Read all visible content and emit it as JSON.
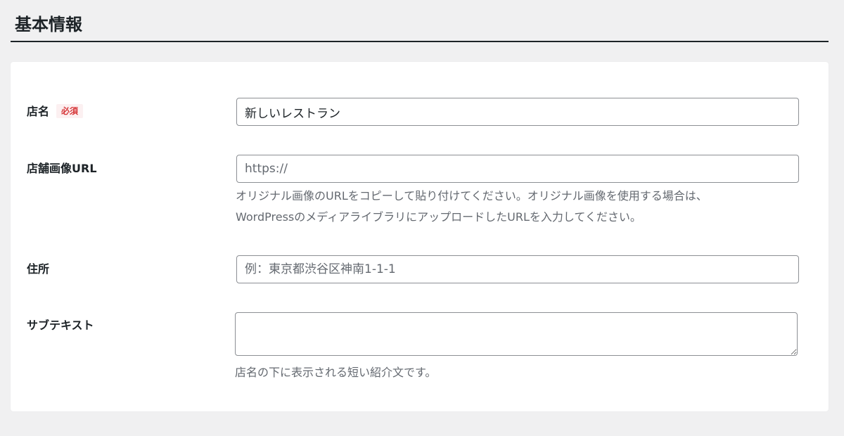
{
  "section": {
    "title": "基本情報"
  },
  "fields": {
    "shop_name": {
      "label": "店名",
      "required_badge": "必須",
      "value": "新しいレストラン"
    },
    "shop_image_url": {
      "label": "店舗画像URL",
      "placeholder": "https://",
      "help_line1": "オリジナル画像のURLをコピーして貼り付けてください。オリジナル画像を使用する場合は、",
      "help_line2": "WordPressのメディアライブラリにアップロードしたURLを入力してください。"
    },
    "address": {
      "label": "住所",
      "placeholder": "例：東京都渋谷区神南1-1-1"
    },
    "subtext": {
      "label": "サブテキスト",
      "value": "",
      "help": "店名の下に表示される短い紹介文です。"
    }
  },
  "colors": {
    "page_background": "#f0f0f1",
    "card_background": "#ffffff",
    "text": "#1d2327",
    "muted_text": "#646970",
    "input_border": "#8c8f94",
    "required_text": "#d63638",
    "required_background": "#fcf0f1"
  }
}
